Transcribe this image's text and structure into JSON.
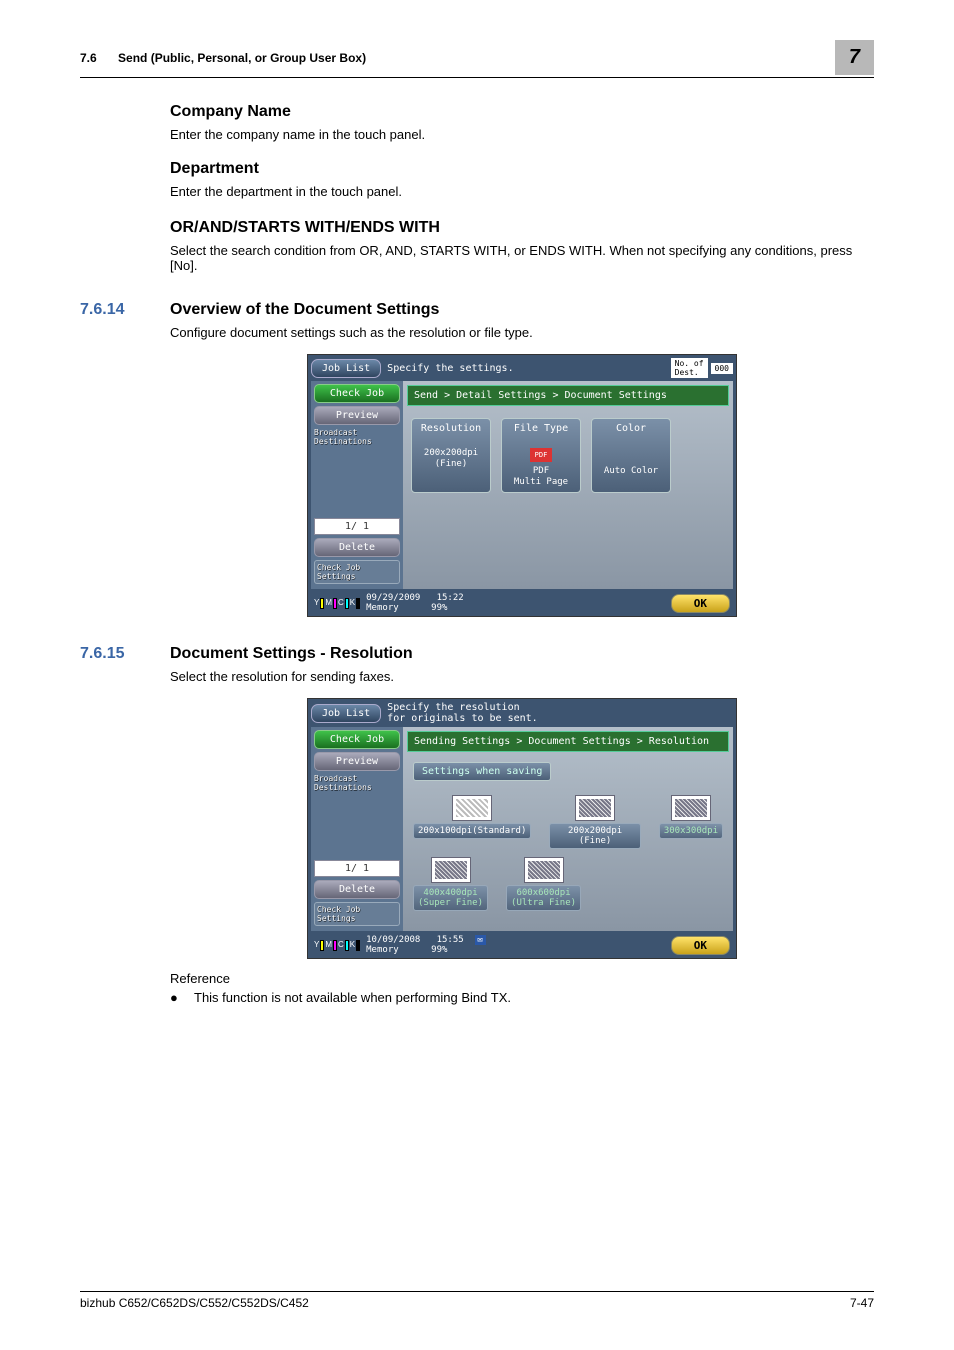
{
  "header": {
    "section_num": "7.6",
    "section_title": "Send (Public, Personal, or Group User Box)",
    "chapter": "7"
  },
  "h_company": "Company Name",
  "p_company": "Enter the company name in the touch panel.",
  "h_department": "Department",
  "p_department": "Enter the department in the touch panel.",
  "h_orand": "OR/AND/STARTS WITH/ENDS WITH",
  "p_orand": "Select the search condition from OR, AND, STARTS WITH, or ENDS WITH. When not specifying any conditions, press [No].",
  "sec1": {
    "num": "7.6.14",
    "title": "Overview of the Document Settings"
  },
  "sec1_body": "Configure document settings such as the resolution or file type.",
  "sec2": {
    "num": "7.6.15",
    "title": "Document Settings - Resolution"
  },
  "sec2_body": "Select the resolution for sending faxes.",
  "screen1": {
    "job_list": "Job List",
    "top_text": "Specify the settings.",
    "dest_no_label": "No. of\nDest.",
    "dest_no_val": "000",
    "check_job": "Check Job",
    "preview": "Preview",
    "broadcast": "Broadcast\nDestinations",
    "page": "1/  1",
    "delete": "Delete",
    "check_settings": "Check Job\nSettings",
    "breadcrumb": "Send > Detail Settings > Document Settings",
    "tiles": {
      "res_title": "Resolution",
      "res_sub": "200x200dpi\n(Fine)",
      "file_title": "File Type",
      "file_icon": "PDF",
      "file_sub": "PDF\nMulti Page",
      "color_title": "Color",
      "color_sub": "Auto Color"
    },
    "footer_date": "09/29/2009",
    "footer_time": "15:22",
    "footer_mem": "Memory",
    "footer_pct": "99%",
    "ok": "OK"
  },
  "screen2": {
    "job_list": "Job List",
    "top_text": "Specify the resolution\nfor originals to be sent.",
    "check_job": "Check Job",
    "preview": "Preview",
    "broadcast": "Broadcast\nDestinations",
    "page": "1/  1",
    "delete": "Delete",
    "check_settings": "Check Job\nSettings",
    "breadcrumb": "Sending Settings > Document Settings > Resolution",
    "saving": "Settings when saving",
    "res": {
      "r1": "200x100dpi(Standard)",
      "r2": "200x200dpi (Fine)",
      "r3": "300x300dpi",
      "r4": "400x400dpi\n(Super Fine)",
      "r5": "600x600dpi\n(Ultra Fine)"
    },
    "footer_date": "10/09/2008",
    "footer_time": "15:55",
    "footer_mem": "Memory",
    "footer_pct": "99%",
    "ok": "OK"
  },
  "reference": "Reference",
  "bullet1": "This function is not available when performing Bind TX.",
  "footer": {
    "model": "bizhub C652/C652DS/C552/C552DS/C452",
    "page": "7-47"
  }
}
